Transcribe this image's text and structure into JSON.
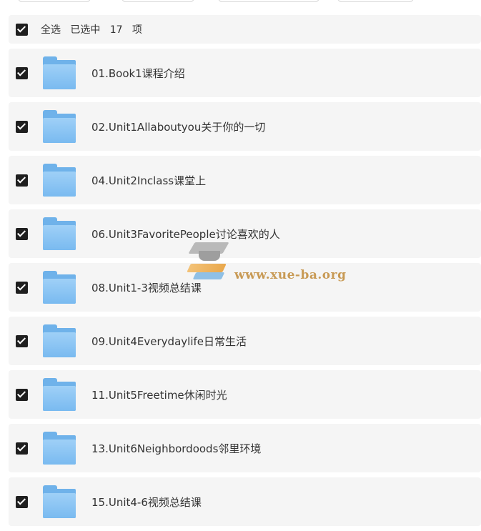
{
  "selection_bar": {
    "select_all_label": "全选",
    "selected_prefix": "已选中",
    "selected_count": "17",
    "selected_unit": "项"
  },
  "items": [
    {
      "label": "01.Book1课程介绍",
      "checked": true
    },
    {
      "label": "02.Unit1Allaboutyou关于你的一切",
      "checked": true
    },
    {
      "label": "04.Unit2Inclass课堂上",
      "checked": true
    },
    {
      "label": "06.Unit3FavoritePeople讨论喜欢的人",
      "checked": true
    },
    {
      "label": "08.Unit1-3视频总结课",
      "checked": true
    },
    {
      "label": "09.Unit4Everydaylife日常生活",
      "checked": true
    },
    {
      "label": "11.Unit5Freetime休闲时光",
      "checked": true
    },
    {
      "label": "13.Unit6Neighbordoods邻里环境",
      "checked": true
    },
    {
      "label": "15.Unit4-6视频总结课",
      "checked": true
    }
  ],
  "watermark": {
    "text": "www.xue-ba.org"
  },
  "colors": {
    "folder": "#79baf0",
    "row_bg": "#f5f5f5",
    "checkbox": "#1f1f1f"
  }
}
